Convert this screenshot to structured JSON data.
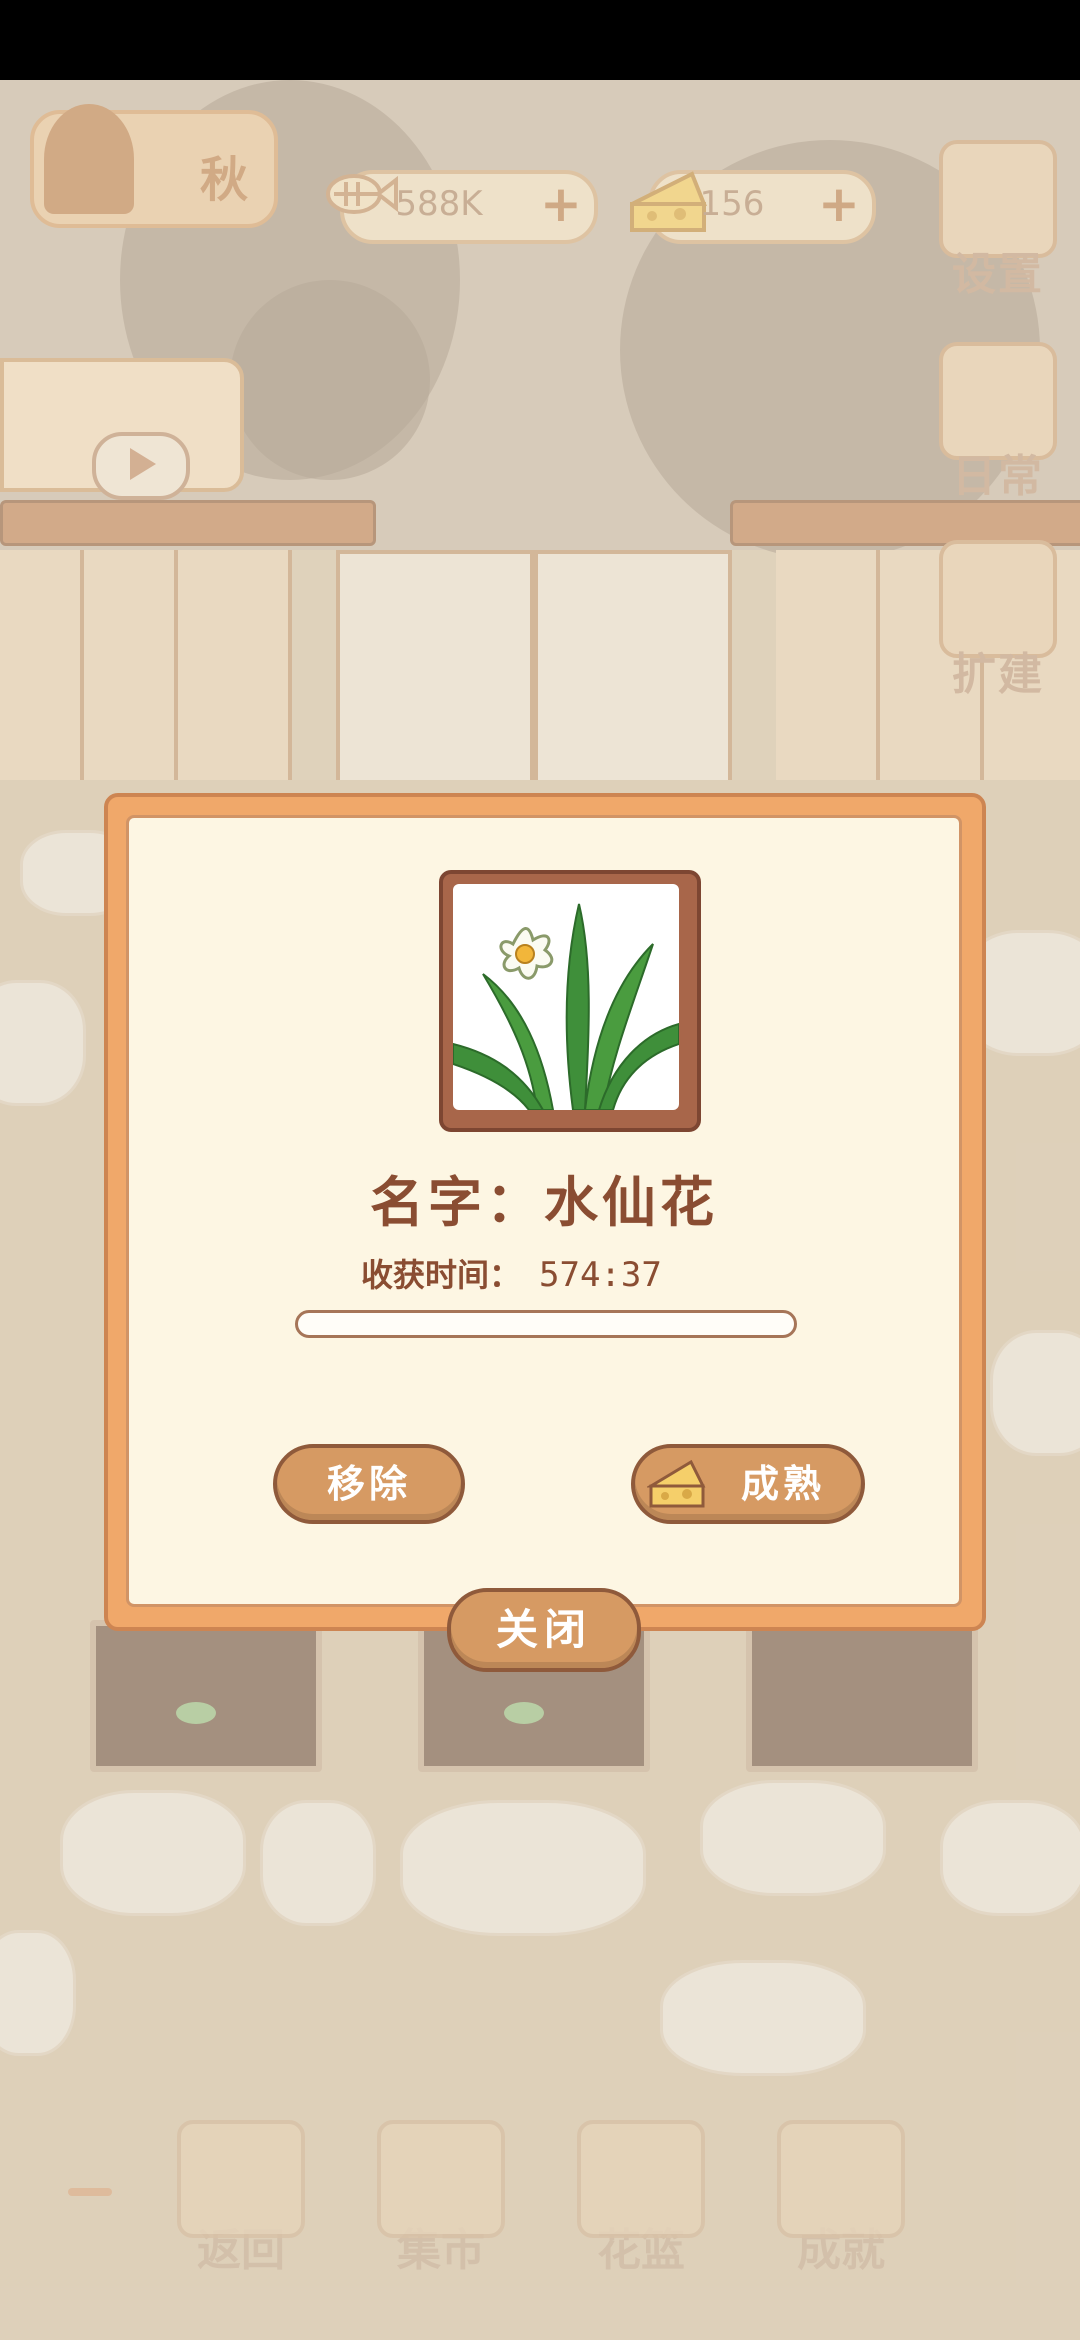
{
  "hud": {
    "season": "秋",
    "fish_count": "588K",
    "cheese_count": "156",
    "settings_label": "设置",
    "daily_label": "日常",
    "expand_label": "扩建"
  },
  "dialog": {
    "title": "名字：水仙花",
    "harvest_label": "收获时间：",
    "harvest_time": "574:37",
    "progress_fraction": 0.0,
    "remove_label": "移除",
    "ripen_label": "成熟",
    "close_label": "关闭"
  },
  "nav": {
    "back": "返回",
    "market": "集市",
    "basket": "花篮",
    "achievements": "成就"
  },
  "colors": {
    "accent": "#d69a63",
    "dialog_border": "#f0a86a",
    "text_brown": "#8a4d32"
  }
}
